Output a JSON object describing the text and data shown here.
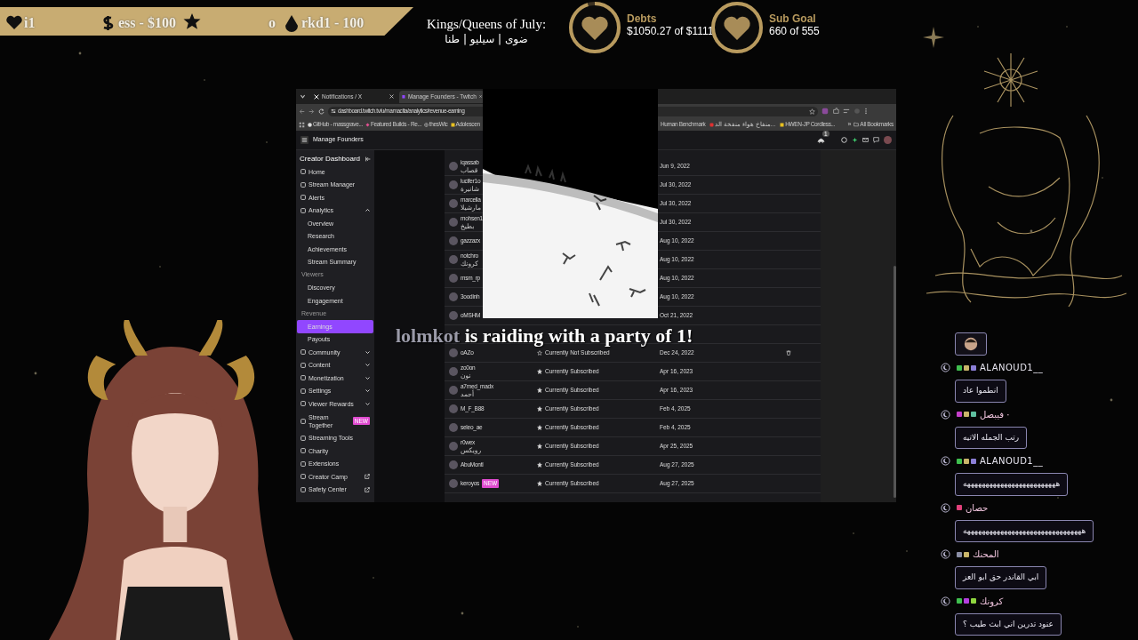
{
  "ticker": [
    {
      "kind": "heart",
      "text": "i1"
    },
    {
      "kind": "dollar",
      "text": "ess - $100"
    },
    {
      "kind": "star"
    },
    {
      "kind": "plain",
      "text": "o"
    },
    {
      "kind": "drop",
      "text": "rkd1 - 100"
    }
  ],
  "monthly_kings": {
    "title": "Kings/Queens of July:",
    "names": "ضوى | سيليو | طنا"
  },
  "goals": [
    {
      "title": "Debts",
      "progress": "$1050.27 of $1111",
      "level": 0.95
    },
    {
      "title": "Sub Goal",
      "progress": "660 of 555",
      "level": 1
    }
  ],
  "browser": {
    "tabs": [
      {
        "title": "Notifications / X",
        "kind": "x",
        "selected": false
      },
      {
        "title": "Manage Founders - Twitch",
        "kind": "twitch",
        "selected": true
      }
    ],
    "url": "dashboard.twitch.tv/u/mamacita/analytics/revenue-earning",
    "bookmarks_left": [
      {
        "title": "GitHub - massgrave...",
        "kind": "github"
      },
      {
        "title": "Featured Builds - Re...",
        "kind": "build"
      },
      {
        "title": "thesWic",
        "kind": "globe"
      },
      {
        "title": "Adolescen",
        "kind": "note"
      }
    ],
    "bookmarks_right": [
      {
        "title": "Human Benchmark",
        "kind": "plain"
      },
      {
        "title": "منفاخ هواء منفخة الد...",
        "kind": "shop"
      },
      {
        "title": "HWEN-JP Cordless...",
        "kind": "note"
      }
    ],
    "overflow": "»",
    "all_bookmarks": "All Bookmarks",
    "notification_count": "1"
  },
  "page_title": "Manage Founders",
  "sidebar": {
    "title": "Creator Dashboard",
    "items": [
      {
        "label": "Home",
        "kind": "item",
        "selected": false
      },
      {
        "label": "Stream Manager",
        "kind": "item",
        "selected": false
      },
      {
        "label": "Alerts",
        "kind": "item",
        "selected": false
      },
      {
        "label": "Analytics",
        "kind": "item",
        "expanded": true,
        "selected": false
      },
      {
        "label": "Overview",
        "kind": "sub",
        "selected": false
      },
      {
        "label": "Research",
        "kind": "sub",
        "selected": false
      },
      {
        "label": "Achievements",
        "kind": "sub",
        "selected": false
      },
      {
        "label": "Stream Summary",
        "kind": "sub",
        "selected": false
      },
      {
        "label": "Viewers",
        "kind": "section"
      },
      {
        "label": "Discovery",
        "kind": "sub",
        "selected": false
      },
      {
        "label": "Engagement",
        "kind": "sub",
        "selected": false
      },
      {
        "label": "Revenue",
        "kind": "section"
      },
      {
        "label": "Earnings",
        "kind": "sub",
        "selected": true
      },
      {
        "label": "Payouts",
        "kind": "sub",
        "selected": false
      },
      {
        "label": "Community",
        "kind": "item",
        "expanded": false,
        "selected": false
      },
      {
        "label": "Content",
        "kind": "item",
        "expanded": false,
        "selected": false
      },
      {
        "label": "Monetization",
        "kind": "item",
        "expanded": false,
        "selected": false
      },
      {
        "label": "Settings",
        "kind": "item",
        "expanded": false,
        "selected": false
      },
      {
        "label": "Viewer Rewards",
        "kind": "item",
        "expanded": false,
        "selected": false
      },
      {
        "label": "Stream Together",
        "kind": "item",
        "badge": "NEW",
        "selected": false
      },
      {
        "label": "Streaming Tools",
        "kind": "item",
        "selected": false
      },
      {
        "label": "Charity",
        "kind": "item",
        "selected": false
      },
      {
        "label": "Extensions",
        "kind": "item",
        "selected": false
      },
      {
        "label": "Creator Camp",
        "kind": "item",
        "external": true,
        "selected": false
      },
      {
        "label": "Safety Center",
        "kind": "item",
        "external": true,
        "selected": false
      }
    ]
  },
  "founders": [
    {
      "kind": "row",
      "name": "iqassab",
      "display_name": "قصاب",
      "date": "Jun 9, 2022"
    },
    {
      "kind": "row",
      "name": "lucifer1o",
      "display_name": "شانيرة",
      "date": "Jul 30, 2022"
    },
    {
      "kind": "row",
      "name": "marcella",
      "display_name": "مارشيلا",
      "date": "Jul 30, 2022"
    },
    {
      "kind": "row",
      "name": "mohsen1",
      "display_name": "بطيخ",
      "date": "Jul 30, 2022"
    },
    {
      "kind": "row",
      "name": "gazzazx",
      "date": "Aug 10, 2022"
    },
    {
      "kind": "row",
      "name": "notchro",
      "display_name": "كرونك",
      "date": "Aug 10, 2022"
    },
    {
      "kind": "row",
      "name": "msm_rp",
      "date": "Aug 10, 2022"
    },
    {
      "kind": "row",
      "name": "3oodinh",
      "date": "Aug 10, 2022"
    },
    {
      "kind": "row",
      "name": "oMSHM",
      "date": "Oct 21, 2022"
    },
    {
      "kind": "covered"
    },
    {
      "kind": "row",
      "name": "oAZo",
      "status": "Currently Not Subscribed",
      "subscribed": false,
      "date": "Dec 24, 2022",
      "deletable": true
    },
    {
      "kind": "row",
      "name": "zo0on",
      "display_name": "نون",
      "status": "Currently Subscribed",
      "subscribed": true,
      "date": "Apr 16, 2023"
    },
    {
      "kind": "row",
      "name": "a7med_madx",
      "display_name": "أحمد",
      "status": "Currently Subscribed",
      "subscribed": true,
      "date": "Apr 16, 2023"
    },
    {
      "kind": "row",
      "name": "M_F_B88",
      "status": "Currently Subscribed",
      "subscribed": true,
      "date": "Feb 4, 2025"
    },
    {
      "kind": "row",
      "name": "seleo_ae",
      "status": "Currently Subscribed",
      "subscribed": true,
      "date": "Feb 4, 2025"
    },
    {
      "kind": "row",
      "name": "r0wex",
      "display_name": "رويكس",
      "status": "Currently Subscribed",
      "subscribed": true,
      "date": "Apr 25, 2025"
    },
    {
      "kind": "row",
      "name": "AbuMontl",
      "status": "Currently Subscribed",
      "subscribed": true,
      "date": "Aug 27, 2025"
    },
    {
      "kind": "row",
      "name": "keroyos",
      "badge": "NEW",
      "status": "Currently Subscribed",
      "subscribed": true,
      "date": "Aug 27, 2025"
    }
  ],
  "raid": {
    "raider": "lolmkot",
    "message": "is raiding with a party of 1!"
  },
  "chat": [
    {
      "kind": "emote"
    },
    {
      "kind": "message",
      "user": "ALANOUD1__",
      "color": "#e8e6f0",
      "badges": [
        {
          "color": "#3fbf4f"
        },
        {
          "color": "#c9b56a"
        },
        {
          "color": "#8b7fd6"
        }
      ],
      "text": "انطموا عاد"
    },
    {
      "kind": "message",
      "user": "فيبصل ·",
      "color": "#f3c6e0",
      "badges": [
        {
          "color": "#c43fc9"
        },
        {
          "color": "#c9b56a"
        },
        {
          "color": "#5fbf9f"
        }
      ],
      "text": "رتب الجمله الاتيه"
    },
    {
      "kind": "message",
      "user": "ALANOUD1__",
      "color": "#e8e6f0",
      "badges": [
        {
          "color": "#3fbf4f"
        },
        {
          "color": "#c9b56a"
        },
        {
          "color": "#8b7fd6"
        }
      ],
      "text": "هههههههههههههههههههههههههه"
    },
    {
      "kind": "message",
      "user": "حصان",
      "color": "#f3c6e0",
      "badges": [
        {
          "color": "#e0407a"
        }
      ],
      "text": "ههههههههههههههههههههههههههههههههه"
    },
    {
      "kind": "message",
      "user": "المحنك",
      "color": "#f3c6e0",
      "badges": [
        {
          "color": "#8b8fa6"
        },
        {
          "color": "#c9b56a"
        }
      ],
      "text": "ابي القاندر حق ابو العز"
    },
    {
      "kind": "message",
      "user": "كرونك",
      "color": "#f3c6e0",
      "badges": [
        {
          "color": "#3fbf4f"
        },
        {
          "color": "#b43fe0"
        },
        {
          "color": "#8fd63f"
        }
      ],
      "text": "عنود تدرين اني ابث طيب ؟"
    }
  ]
}
